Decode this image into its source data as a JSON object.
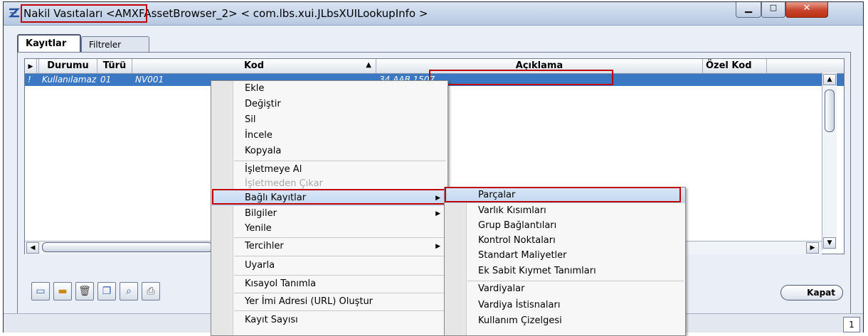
{
  "window": {
    "title": "Nakil Vasıtaları <AMXFAssetBrowser_2> < com.lbs.xui.JLbsXUILookupInfo >",
    "title_icon": "app-logo-icon"
  },
  "tabs": [
    "Kayıtlar",
    "Filtreler"
  ],
  "grid": {
    "columns": [
      "",
      "Durumu",
      "Türü",
      "Kod",
      "Açıklama",
      "Özel Kod"
    ],
    "sort_indicator": "▲",
    "rows": [
      {
        "marker": "!",
        "durumu": "Kullanılamaz",
        "turu": "01",
        "kod": "NV001",
        "aciklama": "34 AAB 1507",
        "ozel_kod": ""
      }
    ]
  },
  "context_menu": {
    "items": [
      {
        "label": "Ekle"
      },
      {
        "label": "Değiştir"
      },
      {
        "label": "Sil"
      },
      {
        "label": "İncele"
      },
      {
        "label": "Kopyala"
      },
      {
        "label": "İşletmeye Al"
      },
      {
        "label": "İşletmeden Çıkar"
      },
      {
        "label": "Bağlı Kayıtlar"
      },
      {
        "label": "Bilgiler"
      },
      {
        "label": "Yenile"
      },
      {
        "label": "Tercihler"
      },
      {
        "label": "Uyarla"
      },
      {
        "label": "Kısayol Tanımla"
      },
      {
        "label": "Yer İmi Adresi (URL) Oluştur"
      },
      {
        "label": "Kayıt Sayısı"
      }
    ]
  },
  "submenu": {
    "items": [
      {
        "label": "Parçalar"
      },
      {
        "label": "Varlık Kısımları"
      },
      {
        "label": "Grup Bağlantıları"
      },
      {
        "label": "Kontrol Noktaları"
      },
      {
        "label": "Standart Maliyetler"
      },
      {
        "label": "Ek Sabit Kıymet Tanımları"
      },
      {
        "label": "Vardiyalar"
      },
      {
        "label": "Vardiya İstisnaları"
      },
      {
        "label": "Kullanım Çizelgesi"
      }
    ]
  },
  "buttons": {
    "right_partial": "Kapat"
  },
  "status": {
    "page": "1"
  },
  "colors": {
    "selection": "#3a78c4",
    "highlight_box": "#c00000"
  }
}
